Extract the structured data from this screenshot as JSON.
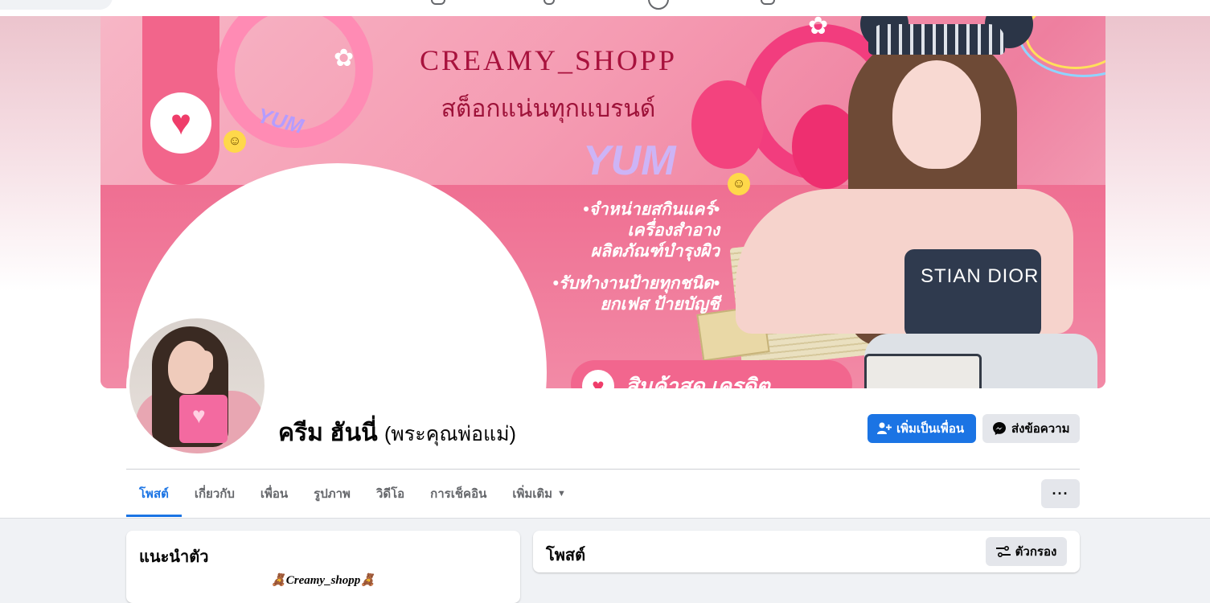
{
  "cover": {
    "title": "CREAMY_SHOPP",
    "subtitle": "สต็อกแน่นทุกแบรนด์",
    "decor_word": "YUM",
    "services_1": [
      "•จำหน่ายสกินแคร์•",
      "เครื่องสำอาง",
      "ผลิตภัณฑ์บำรุงผิว"
    ],
    "services_2": [
      "•รับทำงานป้ายทุกชนิด•",
      "ยกเฟส ป้ายบัญชี"
    ],
    "bottom_banner": "สินค้าสด เครดิต",
    "garment_text": "STIAN DIOR",
    "accent_color": "#ef3d6a"
  },
  "profile": {
    "name": "ครีม ฮันนี่",
    "alternate_name": "(พระคุณพ่อแม่)"
  },
  "actions": {
    "add_friend": "เพิ่มเป็นเพื่อน",
    "message": "ส่งข้อความ"
  },
  "tabs": [
    {
      "label": "โพสต์",
      "active": true
    },
    {
      "label": "เกี่ยวกับ",
      "active": false
    },
    {
      "label": "เพื่อน",
      "active": false
    },
    {
      "label": "รูปภาพ",
      "active": false
    },
    {
      "label": "วิดีโอ",
      "active": false
    },
    {
      "label": "การเช็คอิน",
      "active": false
    },
    {
      "label": "เพิ่มเติม",
      "active": false
    }
  ],
  "more_menu_label": "···",
  "intro": {
    "heading": "แนะนำตัว",
    "bio_line": "🧸Creamy_shopp🧸"
  },
  "posts": {
    "heading": "โพสต์",
    "filter_label": "ตัวกรอง"
  },
  "colors": {
    "primary": "#1b74e4",
    "secondary_button": "#e4e6eb",
    "background": "#f0f2f5"
  }
}
